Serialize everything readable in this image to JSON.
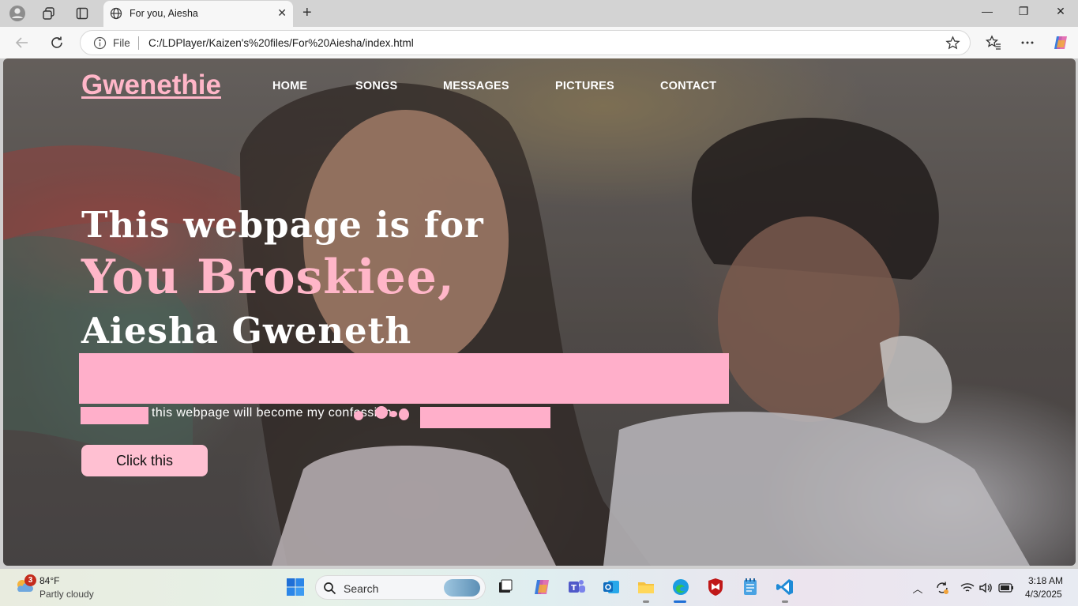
{
  "browser": {
    "tab_title": "For you, Aiesha",
    "address_scheme_label": "File",
    "address_url": "C:/LDPlayer/Kaizen's%20files/For%20Aiesha/index.html"
  },
  "site": {
    "brand": "Gwenethie",
    "nav": [
      "HOME",
      "SONGS",
      "MESSAGES",
      "PICTURES",
      "CONTACT"
    ],
    "hero": {
      "line1": "This webpage is for",
      "line2": "You Broskiee,",
      "line3": "Aiesha Gweneth",
      "subtext": "this webpage will become my confession",
      "button_label": "Click this"
    },
    "colors": {
      "accent_pink": "#ffb6c8",
      "button_pink": "#ffc0d2",
      "text_white": "#ffffff"
    }
  },
  "taskbar": {
    "weather_badge": "3",
    "weather_temp": "84°F",
    "weather_desc": "Partly cloudy",
    "search_placeholder": "Search",
    "clock_time": "3:18 AM",
    "clock_date": "4/3/2025"
  }
}
